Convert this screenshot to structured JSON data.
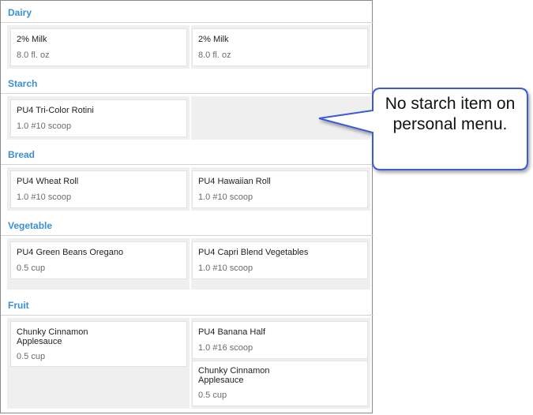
{
  "sections": {
    "dairy": {
      "title": "Dairy",
      "left": {
        "name": "2% Milk",
        "qty": "8.0 fl. oz"
      },
      "right": {
        "name": "2% Milk",
        "qty": "8.0 fl. oz"
      }
    },
    "starch": {
      "title": "Starch",
      "left": {
        "name": "PU4 Tri-Color Rotini",
        "qty": "1.0 #10 scoop"
      }
    },
    "bread": {
      "title": "Bread",
      "left": {
        "name": "PU4 Wheat Roll",
        "qty": "1.0 #10 scoop"
      },
      "right": {
        "name": "PU4 Hawaiian Roll",
        "qty": "1.0 #10 scoop"
      }
    },
    "vegetable": {
      "title": "Vegetable",
      "left": {
        "name": "PU4 Green Beans Oregano",
        "qty": "0.5 cup"
      },
      "right": {
        "name": "PU4 Capri Blend Vegetables",
        "qty": "1.0 #10 scoop"
      }
    },
    "fruit": {
      "title": "Fruit",
      "left": {
        "name": "Chunky Cinnamon Applesauce",
        "qty": "0.5 cup"
      },
      "right1": {
        "name": "PU4 Banana Half",
        "qty": "1.0 #16 scoop"
      },
      "right2": {
        "name": "Chunky Cinnamon Applesauce",
        "qty": "0.5 cup"
      }
    }
  },
  "callout": {
    "text": "No starch item on personal menu."
  },
  "colors": {
    "section_title": "#3a8fd6",
    "callout_border": "#3b5bd6"
  }
}
